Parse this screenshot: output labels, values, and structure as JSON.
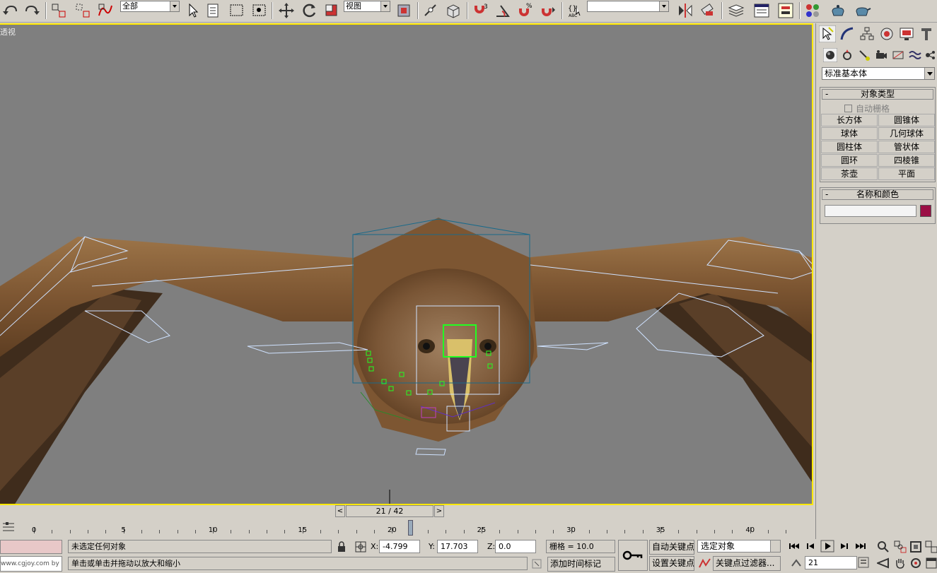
{
  "toolbar": {
    "selection_filter": "全部",
    "reference_coord": "视图",
    "named_selection": ""
  },
  "viewport": {
    "label": "透视"
  },
  "time_slider": {
    "value": "21 / 42",
    "prev": "<",
    "next": ">"
  },
  "trackbar": {
    "ticks": [
      "0",
      "5",
      "10",
      "15",
      "20",
      "25",
      "30",
      "35",
      "40"
    ]
  },
  "status": {
    "selection_info": "未选定任何对象",
    "prompt": "单击或单击并拖动以放大和缩小",
    "watermark": "www.cgjoy.com by 飞龙",
    "x_label": "X:",
    "x_value": "-4.799",
    "y_label": "Y:",
    "y_value": "17.703",
    "z_label": "Z:",
    "z_value": "0.0",
    "grid": "栅格 = 10.0",
    "add_time_tag": "添加时间标记",
    "auto_key": "自动关键点",
    "set_key": "设置关键点",
    "key_mode": "选定对象",
    "key_filters": "关键点过滤器...",
    "frame": "21"
  },
  "command_panel": {
    "category": "标准基本体",
    "object_type": {
      "title": "对象类型",
      "autogrid": "自动栅格",
      "buttons": [
        "长方体",
        "圆锥体",
        "球体",
        "几何球体",
        "圆柱体",
        "管状体",
        "圆环",
        "四棱锥",
        "茶壶",
        "平面"
      ]
    },
    "name_color": {
      "title": "名称和颜色",
      "name_value": "",
      "color": "#9b0f45"
    }
  },
  "colors": {
    "viewport_bg": "#7f7f7f",
    "active_border": "#ffe800",
    "ui_bg": "#d4d0c8"
  }
}
